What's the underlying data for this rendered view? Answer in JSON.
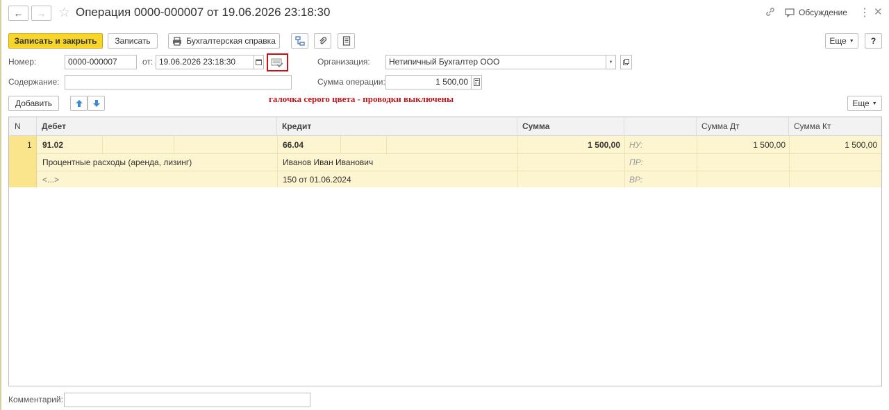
{
  "window": {
    "title": "Операция 0000-000007 от 19.06.2026 23:18:30",
    "discussion_label": "Обсуждение"
  },
  "toolbar": {
    "save_close": "Записать и закрыть",
    "save": "Записать",
    "accounting_ref": "Бухгалтерская справка",
    "more": "Еще",
    "help": "?"
  },
  "form": {
    "number_label": "Номер:",
    "number_value": "0000-000007",
    "from_label": "от:",
    "date_value": "19.06.2026 23:18:30",
    "org_label": "Организация:",
    "org_value": "Нетипичный Бухгалтер ООО",
    "content_label": "Содержание:",
    "content_value": "",
    "sum_label": "Сумма операции:",
    "sum_value": "1 500,00",
    "comment_label": "Комментарий:",
    "comment_value": ""
  },
  "annotation": "галочка серого цвета - проводки выключены",
  "table_toolbar": {
    "add": "Добавить",
    "more": "Еще"
  },
  "table": {
    "headers": {
      "n": "N",
      "debit": "Дебет",
      "credit": "Кредит",
      "sum": "Сумма",
      "sum_dt": "Сумма Дт",
      "sum_kt": "Сумма Кт"
    },
    "rows": [
      {
        "n": "1",
        "debit_account": "91.02",
        "debit_sub1": "Процентные расходы (аренда, лизинг)",
        "debit_sub2": "<...>",
        "credit_account": "66.04",
        "credit_sub1": "Иванов Иван Иванович",
        "credit_sub2": "150 от 01.06.2024",
        "sum": "1 500,00",
        "nu_label": "НУ:",
        "pr_label": "ПР:",
        "vr_label": "ВР:",
        "sum_dt": "1 500,00",
        "sum_kt": "1 500,00"
      }
    ]
  },
  "colors": {
    "primary_button": "#f7d52a",
    "row_highlight": "#fdf5cf",
    "row_number_cell": "#fbe58c",
    "annotation": "#c0141a",
    "annotation_box": "#d20d12",
    "icon_blue": "#3a8ad6"
  }
}
